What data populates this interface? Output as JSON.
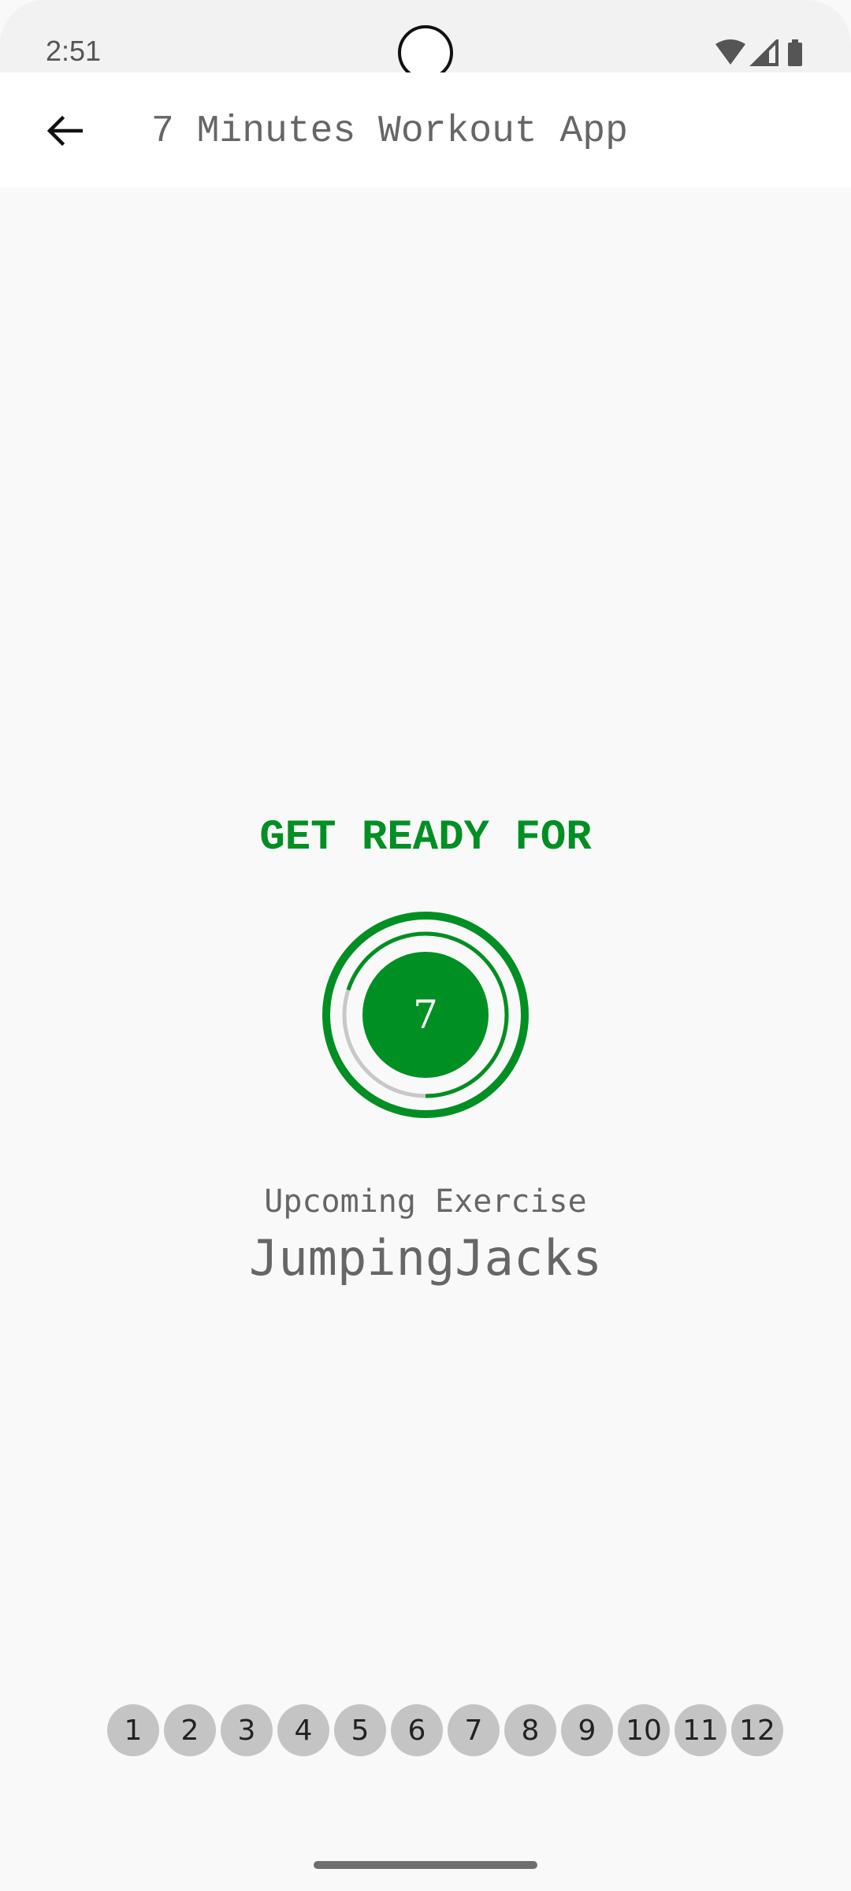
{
  "status_bar": {
    "time": "2:51",
    "icons": [
      "wifi-icon",
      "cellular-signal-icon",
      "battery-icon"
    ]
  },
  "app_bar": {
    "back_icon": "arrow-back-icon",
    "title": "7 Minutes Workout App"
  },
  "ready": {
    "heading": "GET READY FOR",
    "countdown": "7",
    "progress_fraction": 0.7,
    "upcoming_label": "Upcoming Exercise",
    "exercise_name": "JumpingJacks"
  },
  "exercise_status": [
    "1",
    "2",
    "3",
    "4",
    "5",
    "6",
    "7",
    "8",
    "9",
    "10",
    "11",
    "12"
  ],
  "colors": {
    "accent": "#008f22",
    "track": "#c8c8c8",
    "bubble": "#c4c4c4",
    "text_gray": "#666666"
  }
}
